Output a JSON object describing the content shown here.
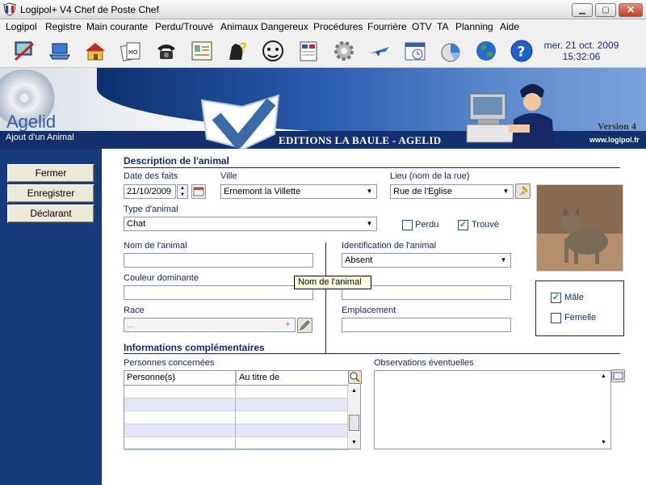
{
  "window": {
    "title": "Logipol+ V4 Chef de Poste Chef",
    "min_glyph": "▁",
    "max_glyph": "▢",
    "close_glyph": "✕"
  },
  "menu": [
    "Logipol",
    "Registre",
    "Main courante",
    "Perdu/Trouvé",
    "Animaux Dangereux",
    "Procédures",
    "Fourrière",
    "OTV",
    "TA",
    "Planning",
    "Aide"
  ],
  "toolbar_icons": [
    "computer-tools-icon",
    "laptop-icon",
    "house-icon",
    "documents-icon",
    "telephone-icon",
    "id-card-icon",
    "dog-question-icon",
    "bulldog-icon",
    "clipboard-icon",
    "gear-icon",
    "plane-icon",
    "calendar-clock-icon",
    "pie-chart-icon",
    "globe-icon",
    "help-icon"
  ],
  "datetime": {
    "date": "mer. 21 oct. 2009",
    "time": "15:32:06"
  },
  "banner": {
    "brand": "Agelid",
    "subtitle": "Ajout d'un Animal",
    "editions": "EDITIONS LA BAULE - AGELID",
    "version": "Version 4",
    "site": "www.logipol.fr"
  },
  "sidebar": {
    "buttons": [
      "Fermer",
      "Enregistrer",
      "Déclarant"
    ]
  },
  "form": {
    "section1_title": "Description de l'animal",
    "date_label": "Date des faits",
    "date_value": "21/10/2009",
    "ville_label": "Ville",
    "ville_value": "Ernemont la Villette",
    "lieu_label": "Lieu (nom de la rue)",
    "lieu_value": "Rue de l'Eglise",
    "type_label": "Type d'animal",
    "type_value": "Chat",
    "perdu_label": "Perdu",
    "perdu_checked": false,
    "trouve_label": "Trouvé",
    "trouve_checked": true,
    "nom_label": "Nom de l'animal",
    "nom_value": "",
    "ident_label": "Identification de l'animal",
    "ident_value": "Absent",
    "couleur_label": "Couleur dominante",
    "couleur_value": "",
    "race_label": "Race",
    "race_value": "...",
    "emplacement_label": "Emplacement",
    "emplacement_value": "",
    "male_label": "Mâle",
    "male_checked": true,
    "femelle_label": "Femelle",
    "femelle_checked": false,
    "section2_title": "Informations complémentaires",
    "personnes_label": "Personnes concernées",
    "grid_columns": [
      "Personne(s)",
      "Au titre de"
    ],
    "obs_label": "Observations éventuelles",
    "tooltip": "Nom de l'animal",
    "check_glyph": "✓"
  }
}
